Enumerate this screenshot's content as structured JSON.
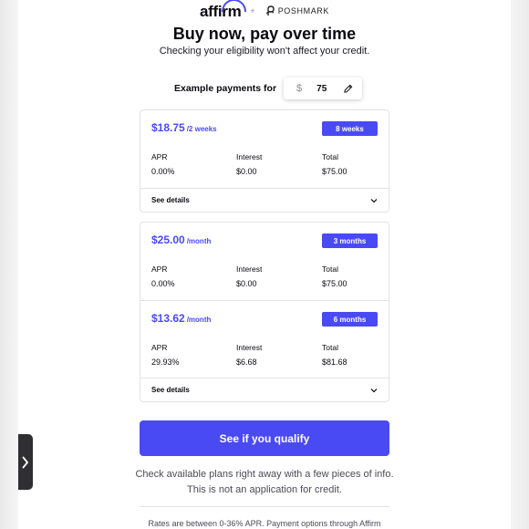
{
  "header": {
    "affirm_logo_text": "affirm",
    "plus": "+",
    "partner_name": "POSHMARK",
    "title": "Buy now, pay over time",
    "subtitle": "Checking your eligibility won't affect your credit."
  },
  "example": {
    "label": "Example payments for",
    "currency_symbol": "$",
    "amount": "75"
  },
  "card1": {
    "plans": [
      {
        "price": "$18.75",
        "period": "/2 weeks",
        "term": "8 weeks",
        "apr_label": "APR",
        "apr": "0.00%",
        "interest_label": "Interest",
        "interest": "$0.00",
        "total_label": "Total",
        "total": "$75.00"
      }
    ],
    "details_label": "See details"
  },
  "card2": {
    "plans": [
      {
        "price": "$25.00",
        "period": "/month",
        "term": "3 months",
        "apr_label": "APR",
        "apr": "0.00%",
        "interest_label": "Interest",
        "interest": "$0.00",
        "total_label": "Total",
        "total": "$75.00"
      },
      {
        "price": "$13.62",
        "period": "/month",
        "term": "6 months",
        "apr_label": "APR",
        "apr": "29.93%",
        "interest_label": "Interest",
        "interest": "$6.68",
        "total_label": "Total",
        "total": "$81.68"
      }
    ],
    "details_label": "See details"
  },
  "cta": {
    "label": "See if you qualify"
  },
  "info": {
    "line1": "Check available plans right away with a few pieces of info.",
    "line2": "This is not an application for credit."
  },
  "footer": {
    "rates": "Rates are between 0-36% APR. Payment options through Affirm"
  },
  "icons": {
    "side_tab": "chevron-right-icon",
    "edit": "pencil-icon",
    "expand": "chevron-down-icon",
    "partner": "poshmark-logo-icon"
  },
  "colors": {
    "accent": "#4a4af4",
    "text": "#0a0a0f",
    "side_tab": "#2e2e33"
  }
}
